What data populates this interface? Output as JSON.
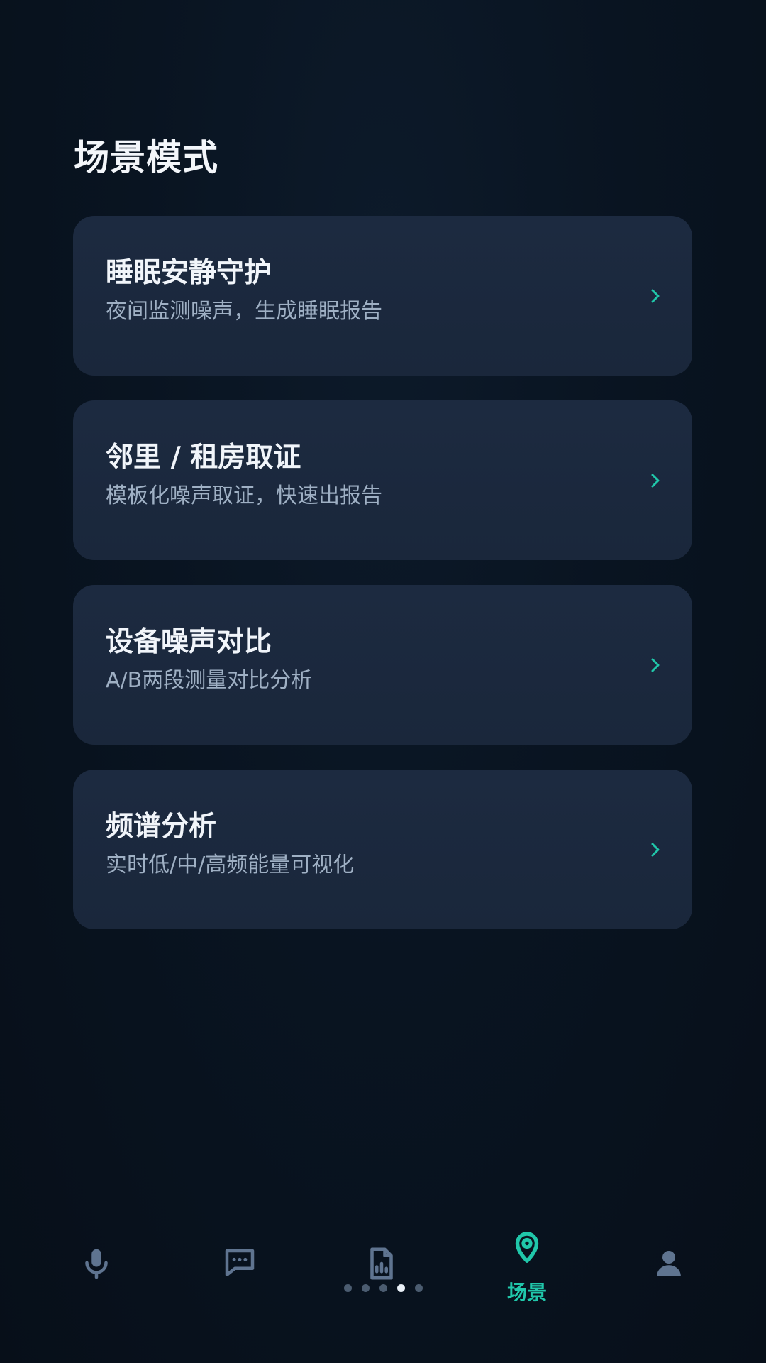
{
  "colors": {
    "accent": "#20c7aa",
    "background": "#091421",
    "card": "#1c2a40",
    "muted_icon": "#5f7490"
  },
  "page": {
    "title": "场景模式"
  },
  "cards": [
    {
      "title": "睡眠安静守护",
      "subtitle": "夜间监测噪声，生成睡眠报告",
      "icon": "chevron-right-icon"
    },
    {
      "title": "邻里 / 租房取证",
      "subtitle": "模板化噪声取证，快速出报告",
      "icon": "chevron-right-icon"
    },
    {
      "title": "设备噪声对比",
      "subtitle": "A/B两段测量对比分析",
      "icon": "chevron-right-icon"
    },
    {
      "title": "频谱分析",
      "subtitle": "实时低/中/高频能量可视化",
      "icon": "chevron-right-icon"
    }
  ],
  "bottom_nav": {
    "items": [
      {
        "icon": "microphone-icon",
        "label": ""
      },
      {
        "icon": "chat-bubble-icon",
        "label": ""
      },
      {
        "icon": "document-chart-icon",
        "label": ""
      },
      {
        "icon": "location-pin-icon",
        "label": "场景",
        "active": true
      },
      {
        "icon": "user-icon",
        "label": ""
      }
    ]
  },
  "pager": {
    "count": 5,
    "active_index": 3
  }
}
